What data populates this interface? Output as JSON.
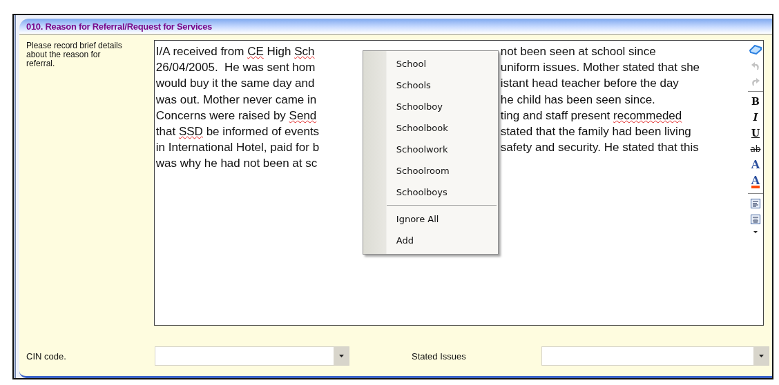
{
  "panel": {
    "title": "010. Reason for Referral/Request for Services"
  },
  "prompt": "Please record brief details about the reason for referral.",
  "editor": {
    "lines": [
      {
        "left": [
          {
            "text": "I/A received from ",
            "misspelled": false
          },
          {
            "text": "CE",
            "misspelled": true
          },
          {
            "text": " High ",
            "misspelled": false
          },
          {
            "text": "Sch",
            "misspelled": true
          }
        ],
        "right": [
          {
            "text": "not been seen at school since",
            "misspelled": false
          }
        ]
      },
      {
        "left": [
          {
            "text": "26/04/2005.  He was sent hom",
            "misspelled": false
          }
        ],
        "right": [
          {
            "text": "uniform issues. Mother stated that she",
            "misspelled": false
          }
        ]
      },
      {
        "left": [
          {
            "text": "would buy it the same day and",
            "misspelled": false
          }
        ],
        "right": [
          {
            "text": "istant head teacher before the day",
            "misspelled": false
          }
        ]
      },
      {
        "left": [
          {
            "text": "was out. Mother never came in",
            "misspelled": false
          }
        ],
        "right": [
          {
            "text": "he child has been seen since.",
            "misspelled": false
          }
        ]
      },
      {
        "left": [
          {
            "text": "Concerns were raised by ",
            "misspelled": false
          },
          {
            "text": "Send",
            "misspelled": true
          }
        ],
        "right": [
          {
            "text": "ting and staff present ",
            "misspelled": false
          },
          {
            "text": "recommeded",
            "misspelled": true
          }
        ]
      },
      {
        "left": [
          {
            "text": "that ",
            "misspelled": false
          },
          {
            "text": "SSD",
            "misspelled": true
          },
          {
            "text": " be informed of events",
            "misspelled": false
          }
        ],
        "right": [
          {
            "text": "stated that the family had been living",
            "misspelled": false
          }
        ]
      },
      {
        "left": [
          {
            "text": "in International Hotel, paid for b",
            "misspelled": false
          }
        ],
        "right": [
          {
            "text": "safety and security. He stated that this",
            "misspelled": false
          }
        ]
      },
      {
        "left": [
          {
            "text": "was why he had not been at sc",
            "misspelled": false
          }
        ]
      }
    ],
    "toolbar": [
      {
        "kind": "eraser"
      },
      {
        "kind": "undo",
        "disabled": true
      },
      {
        "kind": "redo",
        "disabled": true
      },
      {
        "kind": "separator"
      },
      {
        "kind": "bold",
        "label": "B"
      },
      {
        "kind": "italic",
        "label": "I"
      },
      {
        "kind": "underline",
        "label": "U"
      },
      {
        "kind": "strike",
        "label": "ab"
      },
      {
        "kind": "color",
        "label": "A"
      },
      {
        "kind": "highlight",
        "label": "A"
      },
      {
        "kind": "separator"
      },
      {
        "kind": "align-left"
      },
      {
        "kind": "align-center"
      },
      {
        "kind": "more"
      }
    ]
  },
  "context_menu": {
    "items": [
      {
        "kind": "item",
        "label": "School"
      },
      {
        "kind": "item",
        "label": "Schools"
      },
      {
        "kind": "item",
        "label": "Schoolboy"
      },
      {
        "kind": "item",
        "label": "Schoolbook"
      },
      {
        "kind": "item",
        "label": "Schoolwork"
      },
      {
        "kind": "item",
        "label": "Schoolroom"
      },
      {
        "kind": "item",
        "label": "Schoolboys"
      },
      {
        "kind": "separator"
      },
      {
        "kind": "item",
        "label": "Ignore All"
      },
      {
        "kind": "item",
        "label": "Add"
      }
    ]
  },
  "fields": [
    {
      "label": "CIN code."
    },
    {
      "label": "Stated Issues"
    }
  ]
}
